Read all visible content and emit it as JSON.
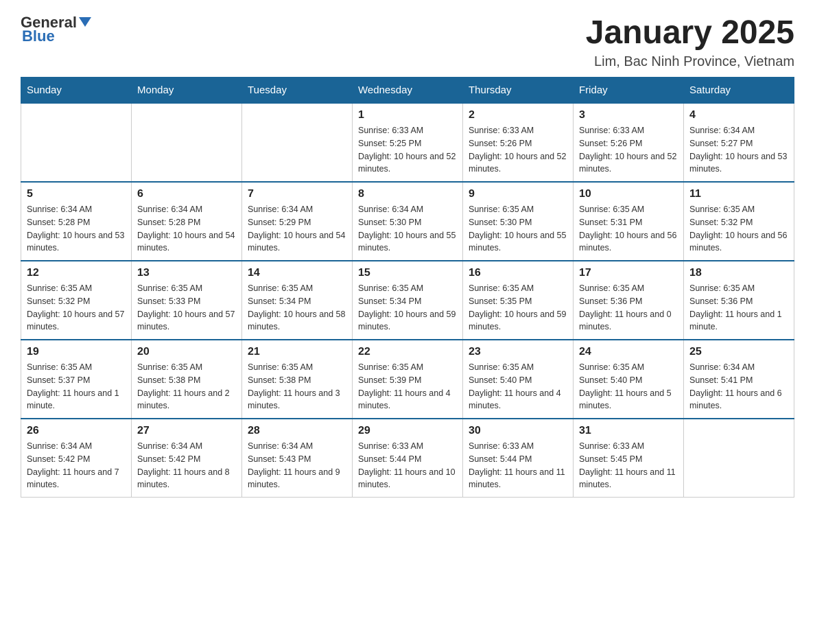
{
  "header": {
    "logo_general": "General",
    "logo_blue": "Blue",
    "month_title": "January 2025",
    "location": "Lim, Bac Ninh Province, Vietnam"
  },
  "days_of_week": [
    "Sunday",
    "Monday",
    "Tuesday",
    "Wednesday",
    "Thursday",
    "Friday",
    "Saturday"
  ],
  "weeks": [
    [
      {
        "day": "",
        "info": ""
      },
      {
        "day": "",
        "info": ""
      },
      {
        "day": "",
        "info": ""
      },
      {
        "day": "1",
        "info": "Sunrise: 6:33 AM\nSunset: 5:25 PM\nDaylight: 10 hours and 52 minutes."
      },
      {
        "day": "2",
        "info": "Sunrise: 6:33 AM\nSunset: 5:26 PM\nDaylight: 10 hours and 52 minutes."
      },
      {
        "day": "3",
        "info": "Sunrise: 6:33 AM\nSunset: 5:26 PM\nDaylight: 10 hours and 52 minutes."
      },
      {
        "day": "4",
        "info": "Sunrise: 6:34 AM\nSunset: 5:27 PM\nDaylight: 10 hours and 53 minutes."
      }
    ],
    [
      {
        "day": "5",
        "info": "Sunrise: 6:34 AM\nSunset: 5:28 PM\nDaylight: 10 hours and 53 minutes."
      },
      {
        "day": "6",
        "info": "Sunrise: 6:34 AM\nSunset: 5:28 PM\nDaylight: 10 hours and 54 minutes."
      },
      {
        "day": "7",
        "info": "Sunrise: 6:34 AM\nSunset: 5:29 PM\nDaylight: 10 hours and 54 minutes."
      },
      {
        "day": "8",
        "info": "Sunrise: 6:34 AM\nSunset: 5:30 PM\nDaylight: 10 hours and 55 minutes."
      },
      {
        "day": "9",
        "info": "Sunrise: 6:35 AM\nSunset: 5:30 PM\nDaylight: 10 hours and 55 minutes."
      },
      {
        "day": "10",
        "info": "Sunrise: 6:35 AM\nSunset: 5:31 PM\nDaylight: 10 hours and 56 minutes."
      },
      {
        "day": "11",
        "info": "Sunrise: 6:35 AM\nSunset: 5:32 PM\nDaylight: 10 hours and 56 minutes."
      }
    ],
    [
      {
        "day": "12",
        "info": "Sunrise: 6:35 AM\nSunset: 5:32 PM\nDaylight: 10 hours and 57 minutes."
      },
      {
        "day": "13",
        "info": "Sunrise: 6:35 AM\nSunset: 5:33 PM\nDaylight: 10 hours and 57 minutes."
      },
      {
        "day": "14",
        "info": "Sunrise: 6:35 AM\nSunset: 5:34 PM\nDaylight: 10 hours and 58 minutes."
      },
      {
        "day": "15",
        "info": "Sunrise: 6:35 AM\nSunset: 5:34 PM\nDaylight: 10 hours and 59 minutes."
      },
      {
        "day": "16",
        "info": "Sunrise: 6:35 AM\nSunset: 5:35 PM\nDaylight: 10 hours and 59 minutes."
      },
      {
        "day": "17",
        "info": "Sunrise: 6:35 AM\nSunset: 5:36 PM\nDaylight: 11 hours and 0 minutes."
      },
      {
        "day": "18",
        "info": "Sunrise: 6:35 AM\nSunset: 5:36 PM\nDaylight: 11 hours and 1 minute."
      }
    ],
    [
      {
        "day": "19",
        "info": "Sunrise: 6:35 AM\nSunset: 5:37 PM\nDaylight: 11 hours and 1 minute."
      },
      {
        "day": "20",
        "info": "Sunrise: 6:35 AM\nSunset: 5:38 PM\nDaylight: 11 hours and 2 minutes."
      },
      {
        "day": "21",
        "info": "Sunrise: 6:35 AM\nSunset: 5:38 PM\nDaylight: 11 hours and 3 minutes."
      },
      {
        "day": "22",
        "info": "Sunrise: 6:35 AM\nSunset: 5:39 PM\nDaylight: 11 hours and 4 minutes."
      },
      {
        "day": "23",
        "info": "Sunrise: 6:35 AM\nSunset: 5:40 PM\nDaylight: 11 hours and 4 minutes."
      },
      {
        "day": "24",
        "info": "Sunrise: 6:35 AM\nSunset: 5:40 PM\nDaylight: 11 hours and 5 minutes."
      },
      {
        "day": "25",
        "info": "Sunrise: 6:34 AM\nSunset: 5:41 PM\nDaylight: 11 hours and 6 minutes."
      }
    ],
    [
      {
        "day": "26",
        "info": "Sunrise: 6:34 AM\nSunset: 5:42 PM\nDaylight: 11 hours and 7 minutes."
      },
      {
        "day": "27",
        "info": "Sunrise: 6:34 AM\nSunset: 5:42 PM\nDaylight: 11 hours and 8 minutes."
      },
      {
        "day": "28",
        "info": "Sunrise: 6:34 AM\nSunset: 5:43 PM\nDaylight: 11 hours and 9 minutes."
      },
      {
        "day": "29",
        "info": "Sunrise: 6:33 AM\nSunset: 5:44 PM\nDaylight: 11 hours and 10 minutes."
      },
      {
        "day": "30",
        "info": "Sunrise: 6:33 AM\nSunset: 5:44 PM\nDaylight: 11 hours and 11 minutes."
      },
      {
        "day": "31",
        "info": "Sunrise: 6:33 AM\nSunset: 5:45 PM\nDaylight: 11 hours and 11 minutes."
      },
      {
        "day": "",
        "info": ""
      }
    ]
  ]
}
